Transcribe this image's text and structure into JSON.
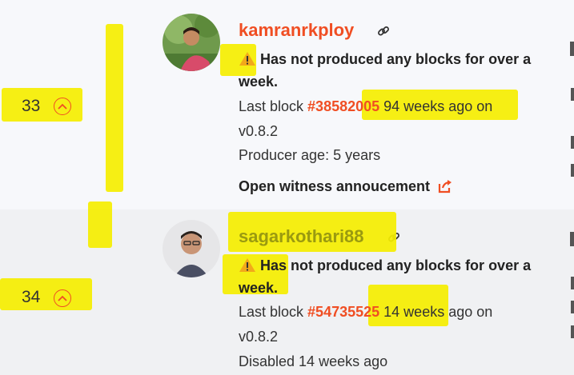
{
  "witnesses": [
    {
      "rank": "33",
      "name": "kamranrkploy",
      "warning_icon": "warning-triangle-icon",
      "warning_line1": "Has not produced any blocks for over a",
      "warning_line2": "week.",
      "last_block_prefix": "Last block ",
      "block_number": "#38582005",
      "last_block_suffix": " 94 weeks ago on",
      "version": "v0.8.2",
      "extra": "Producer age: 5 years",
      "announcement": "Open witness annoucement"
    },
    {
      "rank": "34",
      "name": "sagarkothari88",
      "warning_icon": "warning-triangle-icon",
      "warning_line1": "Has not produced any blocks for over a",
      "warning_line2": "week.",
      "last_block_prefix": "Last block ",
      "block_number": "#54735525",
      "last_block_suffix": " 14 weeks ago on",
      "version": "v0.8.2",
      "extra": "Disabled 14 weeks ago"
    }
  ],
  "colors": {
    "accent": "#f04e23",
    "highlighter": "#f5ee00",
    "warning": "#f2a91a"
  }
}
